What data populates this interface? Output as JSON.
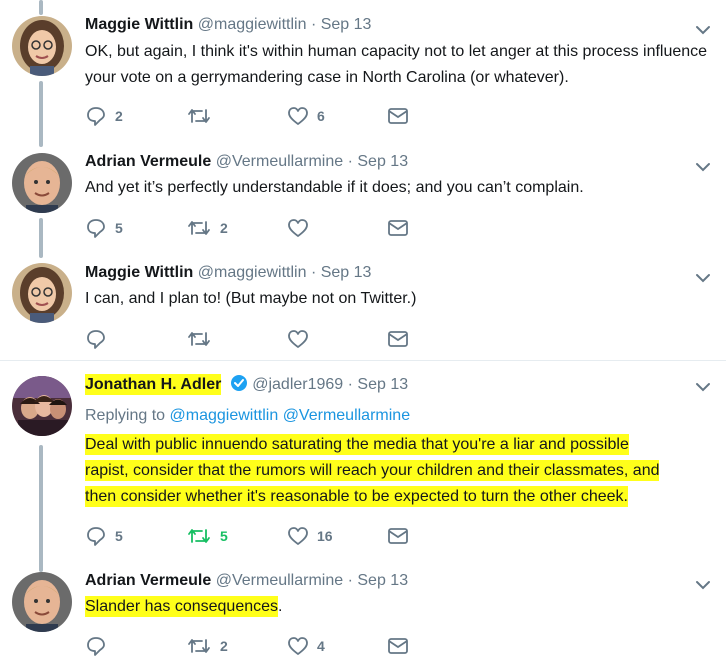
{
  "colors": {
    "accent": "#1b95e0",
    "muted": "#657786",
    "retweet_active": "#17bf63",
    "highlight": "#ffff1a",
    "thread_line": "#aab8c2"
  },
  "tweets": [
    {
      "name": "Maggie Wittlin",
      "handle": "@maggiewittlin",
      "sep": "·",
      "date": "Sep 13",
      "text": "OK, but again, I think it's within human capacity not to let anger at this process influence your vote on a gerrymandering case in North Carolina (or whatever).",
      "replies": "2",
      "retweets": "",
      "likes": "6"
    },
    {
      "name": "Adrian Vermeule",
      "handle": "@Vermeullarmine",
      "sep": "·",
      "date": "Sep 13",
      "text": "And yet it’s perfectly understandable if it does; and you can’t complain.",
      "replies": "5",
      "retweets": "2",
      "likes": ""
    },
    {
      "name": "Maggie Wittlin",
      "handle": "@maggiewittlin",
      "sep": "·",
      "date": "Sep 13",
      "text": "I can, and I plan to! (But maybe not on Twitter.)",
      "replies": "",
      "retweets": "",
      "likes": ""
    },
    {
      "name": "Jonathan H. Adler",
      "handle": "@jadler1969",
      "sep": "·",
      "date": "Sep 13",
      "replying_prefix": "Replying to",
      "replying_to_1": "@maggiewittlin",
      "replying_to_2": "@Vermeullarmine",
      "text_line_1": "Deal with public innuendo saturating the media that you're a liar and possible",
      "text_line_2": "rapist, consider that the rumors will reach your children and their classmates, and",
      "text_line_3": "then consider whether it's reasonable to be expected to turn the other cheek.",
      "replies": "5",
      "retweets": "5",
      "likes": "16"
    },
    {
      "name": "Adrian Vermeule",
      "handle": "@Vermeullarmine",
      "sep": "·",
      "date": "Sep 13",
      "text_highlighted": "Slander has consequences",
      "text_tail": ".",
      "replies": "",
      "retweets": "2",
      "likes": "4"
    }
  ]
}
